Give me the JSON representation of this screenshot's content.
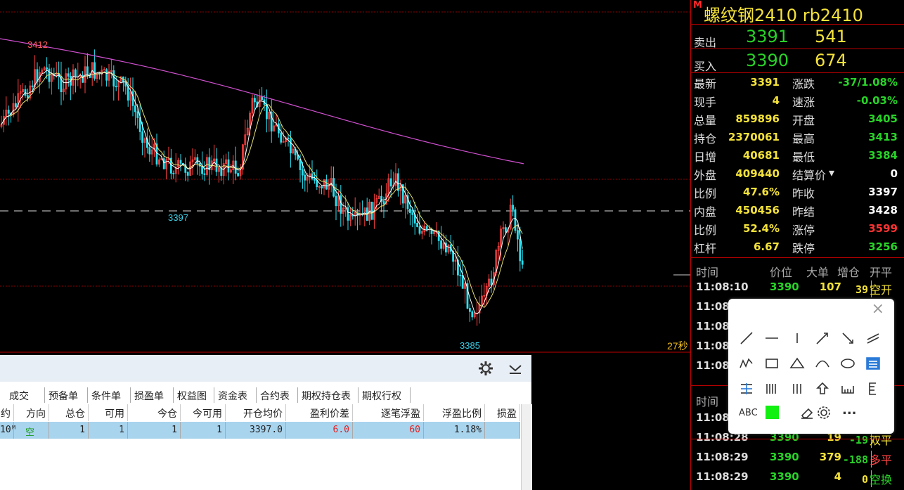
{
  "chart": {
    "price_labels": [
      "3412",
      "3397",
      "3385"
    ],
    "countdown": "27秒"
  },
  "chart_data": {
    "type": "candlestick",
    "ylim": [
      3380,
      3416
    ],
    "reference_price": 3397,
    "high_label": 3412,
    "low_label": 3385,
    "level_3397_label": 3397
  },
  "panel": {
    "flag": "M",
    "title": "螺纹钢2410  rb2410",
    "ask": {
      "label": "卖出",
      "price": "3391",
      "volume": "541"
    },
    "bid": {
      "label": "买入",
      "price": "3390",
      "volume": "674"
    },
    "quotes": [
      {
        "k1": "最新",
        "v1": "3391",
        "c1": "#f4e23a",
        "k2": "涨跌",
        "v2": "-37/1.08%",
        "c2": "#28d328"
      },
      {
        "k1": "现手",
        "v1": "4",
        "c1": "#f4e23a",
        "k2": "速涨",
        "v2": "-0.03%",
        "c2": "#28d328"
      },
      {
        "k1": "总量",
        "v1": "859896",
        "c1": "#f4e23a",
        "k2": "开盘",
        "v2": "3405",
        "c2": "#28d328"
      },
      {
        "k1": "持仓",
        "v1": "2370061",
        "c1": "#f4e23a",
        "k2": "最高",
        "v2": "3413",
        "c2": "#28d328"
      },
      {
        "k1": "日增",
        "v1": "40681",
        "c1": "#f4e23a",
        "k2": "最低",
        "v2": "3384",
        "c2": "#28d328"
      },
      {
        "k1": "外盘",
        "v1": "409440",
        "c1": "#f4e23a",
        "k2": "结算价",
        "v2": "0",
        "c2": "#ffffff"
      },
      {
        "k1": "比例",
        "v1": "47.6%",
        "c1": "#f4e23a",
        "k2": "昨收",
        "v2": "3397",
        "c2": "#ffffff"
      },
      {
        "k1": "内盘",
        "v1": "450456",
        "c1": "#f4e23a",
        "k2": "昨结",
        "v2": "3428",
        "c2": "#ffffff"
      },
      {
        "k1": "比例",
        "v1": "52.4%",
        "c1": "#f4e23a",
        "k2": "涨停",
        "v2": "3599",
        "c2": "#ff3333"
      },
      {
        "k1": "杠杆",
        "v1": "6.67",
        "c1": "#f4e23a",
        "k2": "跌停",
        "v2": "3256",
        "c2": "#28d328"
      }
    ],
    "tick_headers": [
      "时间",
      "价位",
      "大单",
      "增仓",
      "开平"
    ],
    "ticks_top": [
      {
        "t": "11:08:10",
        "p": "3390",
        "v": "107",
        "d": "39",
        "n": "空开",
        "dc": "#f4e23a",
        "nc": "#f4e23a"
      },
      {
        "t": "11:08:",
        "p": "",
        "v": "",
        "d": "",
        "n": "",
        "dc": "#f4e23a",
        "nc": "#f4e23a"
      },
      {
        "t": "11:08:",
        "p": "",
        "v": "",
        "d": "",
        "n": "",
        "dc": "#f4e23a",
        "nc": "#f4e23a"
      },
      {
        "t": "11:08:",
        "p": "",
        "v": "",
        "d": "",
        "n": "",
        "dc": "#f4e23a",
        "nc": "#f4e23a"
      },
      {
        "t": "11:08:",
        "p": "",
        "v": "",
        "d": "",
        "n": "",
        "dc": "#f4e23a",
        "nc": "#f4e23a"
      }
    ],
    "tick_headers2": [
      "时间"
    ],
    "ticks_bottom": [
      {
        "t": "11:08:",
        "p": "",
        "v": "",
        "d": "",
        "n": "",
        "dc": "#f4e23a",
        "nc": "#f4e23a"
      },
      {
        "t": "11:08:28",
        "p": "3390",
        "v": "19",
        "d": "-19",
        "n": "双平",
        "dc": "#28d328",
        "nc": "#f4e23a"
      },
      {
        "t": "11:08:29",
        "p": "3390",
        "v": "379",
        "d": "-188",
        "n": "多平",
        "dc": "#28d328",
        "nc": "#ff4444"
      },
      {
        "t": "11:08:29",
        "p": "3390",
        "v": "4",
        "d": "0",
        "n": "空换",
        "dc": "#f4e23a",
        "nc": "#28d328"
      }
    ]
  },
  "orders": {
    "tabs": [
      "成交",
      "预备单",
      "条件单",
      "损盈单",
      "权益图",
      "资金表",
      "合约表",
      "期权持仓表",
      "期权行权"
    ],
    "headers": [
      "约",
      "方向",
      "总仓",
      "可用",
      "今仓",
      "今可用",
      "开仓均价",
      "盈利价差",
      "逐笔浮盈",
      "浮盈比例",
      "损盈"
    ],
    "row": [
      "10ᴹ",
      "空",
      "1",
      "1",
      "1",
      "1",
      "3397.0",
      "6.0",
      "60",
      "1.18%",
      ""
    ]
  },
  "toolbar": {
    "close": "×",
    "abc": "ABC",
    "more": "..."
  }
}
